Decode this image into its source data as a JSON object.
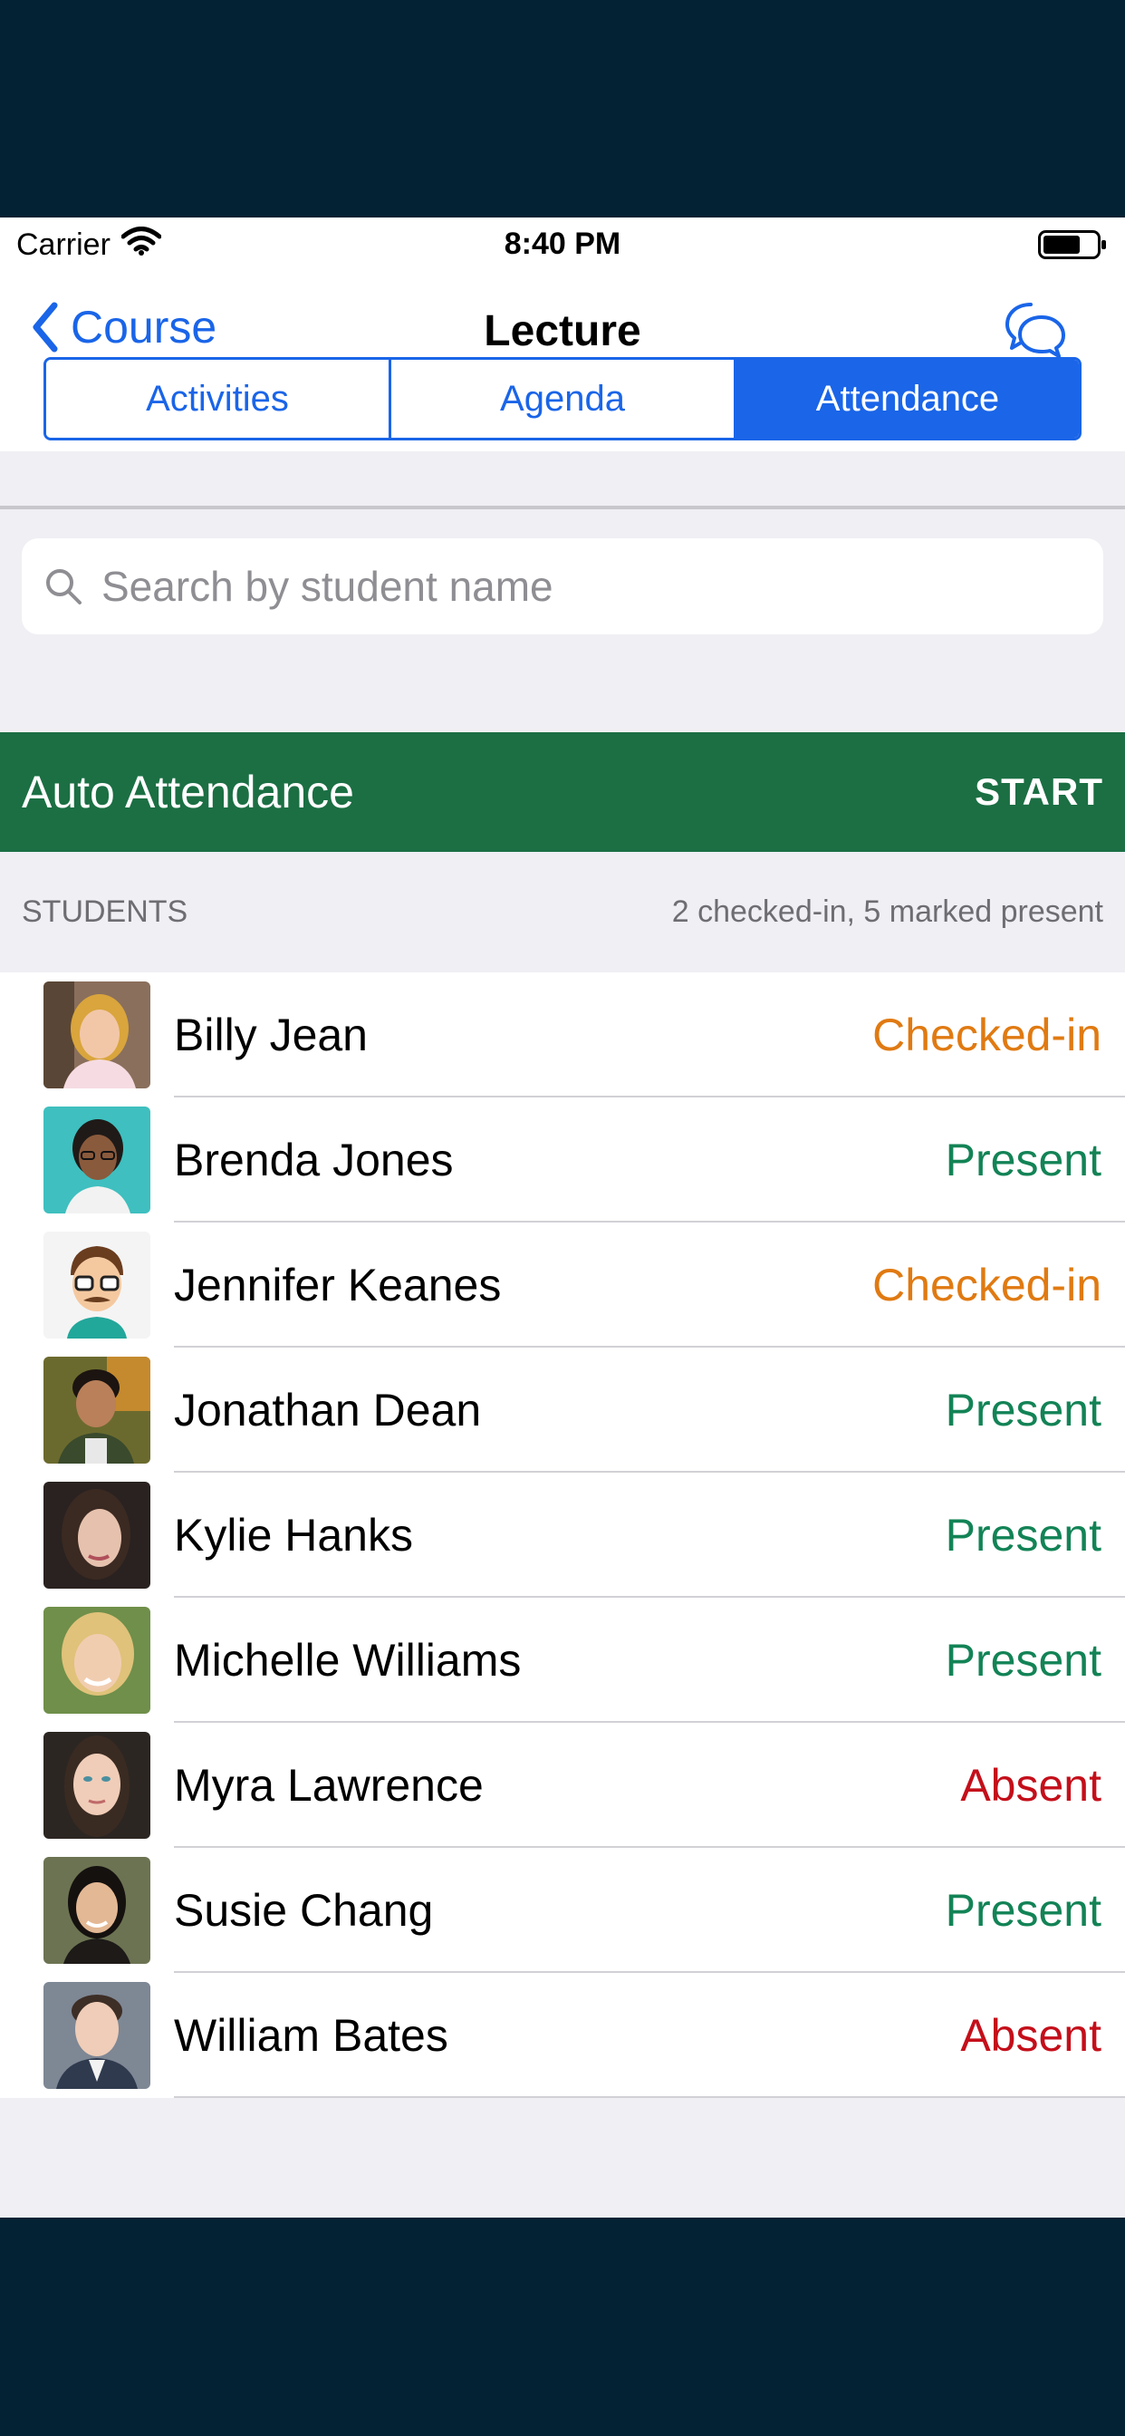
{
  "status_bar": {
    "carrier": "Carrier",
    "time": "8:40 PM"
  },
  "nav": {
    "back_label": "Course",
    "title": "Lecture"
  },
  "tabs": [
    {
      "label": "Activities",
      "active": false
    },
    {
      "label": "Agenda",
      "active": false
    },
    {
      "label": "Attendance",
      "active": true
    }
  ],
  "search": {
    "placeholder": "Search by student name",
    "value": ""
  },
  "auto_attendance": {
    "label": "Auto Attendance",
    "action": "START"
  },
  "students_section": {
    "title": "STUDENTS",
    "summary": "2 checked-in, 5 marked present"
  },
  "students": [
    {
      "name": "Billy Jean",
      "status": "Checked-in"
    },
    {
      "name": "Brenda Jones",
      "status": "Present"
    },
    {
      "name": "Jennifer Keanes",
      "status": "Checked-in"
    },
    {
      "name": "Jonathan Dean",
      "status": "Present"
    },
    {
      "name": "Kylie Hanks",
      "status": "Present"
    },
    {
      "name": "Michelle Williams",
      "status": "Present"
    },
    {
      "name": "Myra Lawrence",
      "status": "Absent"
    },
    {
      "name": "Susie Chang",
      "status": "Present"
    },
    {
      "name": "William Bates",
      "status": "Absent"
    }
  ],
  "colors": {
    "accent": "#1a65e8",
    "auto_bar": "#1b6f43",
    "checked_in": "#e07a12",
    "present": "#138356",
    "absent": "#c40f1a",
    "outer_background": "#032233"
  },
  "icons": [
    "wifi-icon",
    "battery-icon",
    "back-chevron-icon",
    "chat-bubbles-icon",
    "search-icon"
  ]
}
